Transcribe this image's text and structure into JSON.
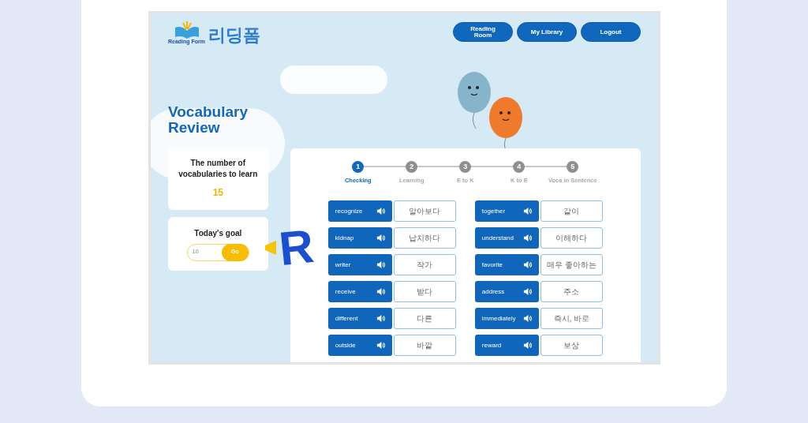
{
  "logo": {
    "title": "리딩폼",
    "subtitle": "Reading Form"
  },
  "nav": [
    "Reading Room",
    "My Library",
    "Logout"
  ],
  "title": "Vocabulary Review",
  "count_card": {
    "label": "The number of vocabularies to learn",
    "value": "15"
  },
  "goal_card": {
    "label": "Today's goal",
    "value": "10",
    "button": "Go"
  },
  "mascot_letter": "R",
  "steps": [
    {
      "number": "1",
      "label": "Checking",
      "selected": true
    },
    {
      "number": "2",
      "label": "Learning",
      "selected": false
    },
    {
      "number": "3",
      "label": "E to K",
      "selected": false
    },
    {
      "number": "4",
      "label": "K to E",
      "selected": false
    },
    {
      "number": "5",
      "label": "Voca in Sentence",
      "selected": false
    }
  ],
  "words": [
    [
      {
        "word": "recognize",
        "meaning": "알아보다"
      },
      {
        "word": "kidnap",
        "meaning": "납치하다"
      },
      {
        "word": "writer",
        "meaning": "작가"
      },
      {
        "word": "receive",
        "meaning": "받다"
      },
      {
        "word": "different",
        "meaning": "다른"
      },
      {
        "word": "outside",
        "meaning": "바깥"
      }
    ],
    [
      {
        "word": "together",
        "meaning": "같이"
      },
      {
        "word": "understand",
        "meaning": "이해하다"
      },
      {
        "word": "favorite",
        "meaning": "매우 좋아하는"
      },
      {
        "word": "address",
        "meaning": "주소"
      },
      {
        "word": "immediately",
        "meaning": "즉시, 바로"
      },
      {
        "word": "reward",
        "meaning": "보상"
      }
    ]
  ]
}
